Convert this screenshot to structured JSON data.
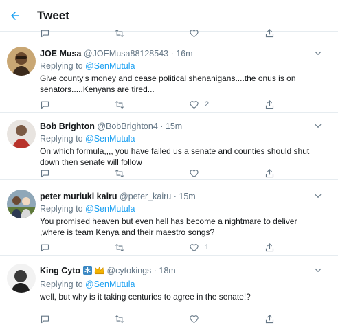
{
  "header": {
    "title": "Tweet"
  },
  "replying_prefix": "Replying to",
  "tweets": [
    {
      "name": "JOE Musa",
      "handle": "@JOEMusa88128543",
      "time": "16m",
      "reply_to": "@SenMutula",
      "text": "Give county's money and cease political shenanigans....the onus is on senators.....Kenyans are tired...",
      "likes": "2",
      "retweets": ""
    },
    {
      "name": "Bob Brighton",
      "handle": "@BobBrighton4",
      "time": "15m",
      "reply_to": "@SenMutula",
      "text": "On which formula,,,, you have failed us a senate and counties should shut down then senate will follow",
      "likes": "",
      "retweets": ""
    },
    {
      "name": "peter muriuki kairu",
      "handle": "@peter_kairu",
      "time": "15m",
      "reply_to": "@SenMutula",
      "text": "You promised heaven but even hell has become a nightmare to deliver ,where is team Kenya and their maestro songs?",
      "likes": "1",
      "retweets": ""
    },
    {
      "name": "King Cyto",
      "handle": "@cytokings",
      "time": "18m",
      "reply_to": "@SenMutula",
      "text": "well, but why is it taking centuries to agree in the senate!?",
      "likes": "",
      "retweets": ""
    }
  ],
  "icons": {
    "back": "back-arrow-icon",
    "reply": "reply-icon",
    "retweet": "retweet-icon",
    "like": "heart-icon",
    "share": "share-icon",
    "more": "chevron-down-icon"
  },
  "colors": {
    "accent": "#1da1f2",
    "text": "#14171a",
    "secondary": "#657786",
    "divider": "#e6ecf0"
  }
}
